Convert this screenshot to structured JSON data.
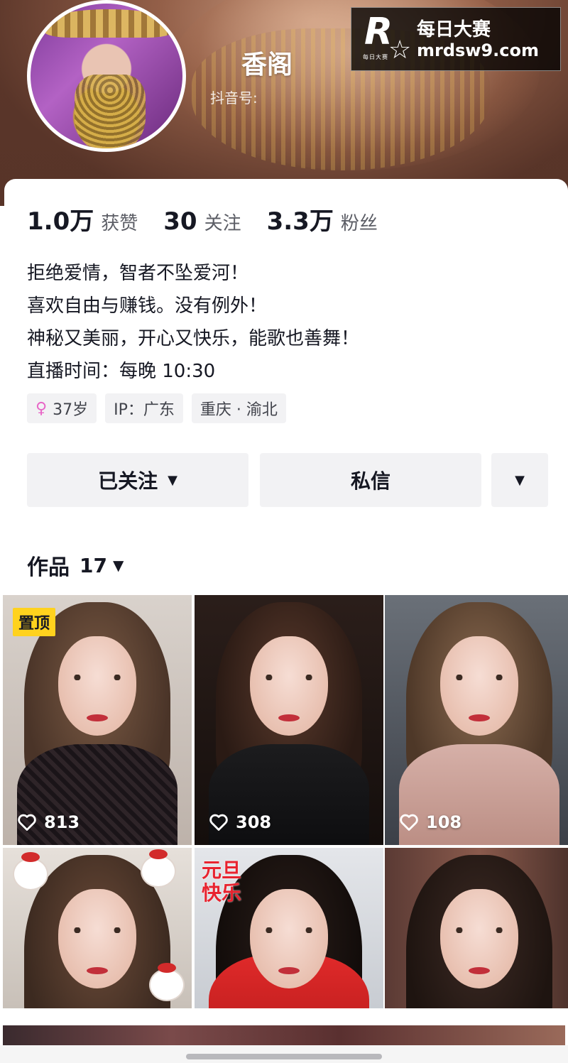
{
  "profile": {
    "name": "香阁",
    "douyin_id_label": "抖音号:",
    "stats": [
      {
        "value": "1.0万",
        "label": "获赞"
      },
      {
        "value": "30",
        "label": "关注"
      },
      {
        "value": "3.3万",
        "label": "粉丝"
      }
    ],
    "bio": [
      "拒绝爱情，智者不坠爱河！",
      "喜欢自由与赚钱。没有例外！",
      "神秘又美丽，开心又快乐，能歌也善舞！",
      "直播时间：每晚 10:30"
    ],
    "tags": {
      "age": "37岁",
      "ip": "IP：广东",
      "location": "重庆 · 渝北"
    }
  },
  "actions": {
    "follow_label": "已关注",
    "message_label": "私信"
  },
  "works": {
    "label": "作品",
    "count": "17",
    "pinned_label": "置顶",
    "items": [
      {
        "likes": "813"
      },
      {
        "likes": "308"
      },
      {
        "likes": "108"
      },
      {
        "likes": ""
      },
      {
        "likes": "",
        "sticker": "元旦快乐"
      },
      {
        "likes": ""
      }
    ]
  },
  "watermark": {
    "logo_letter": "R",
    "logo_sub": "每日大赛",
    "title": "每日大赛",
    "url": "mrdsw9.com"
  },
  "colors": {
    "pinned_badge": "#ffd21e",
    "gender_icon": "#e866c7",
    "button_bg": "#f2f2f4",
    "text_primary": "#161823",
    "text_secondary": "#5c5e66"
  },
  "icons": {
    "gender": "female-icon",
    "like": "heart-icon",
    "dropdown": "caret-down-icon"
  }
}
